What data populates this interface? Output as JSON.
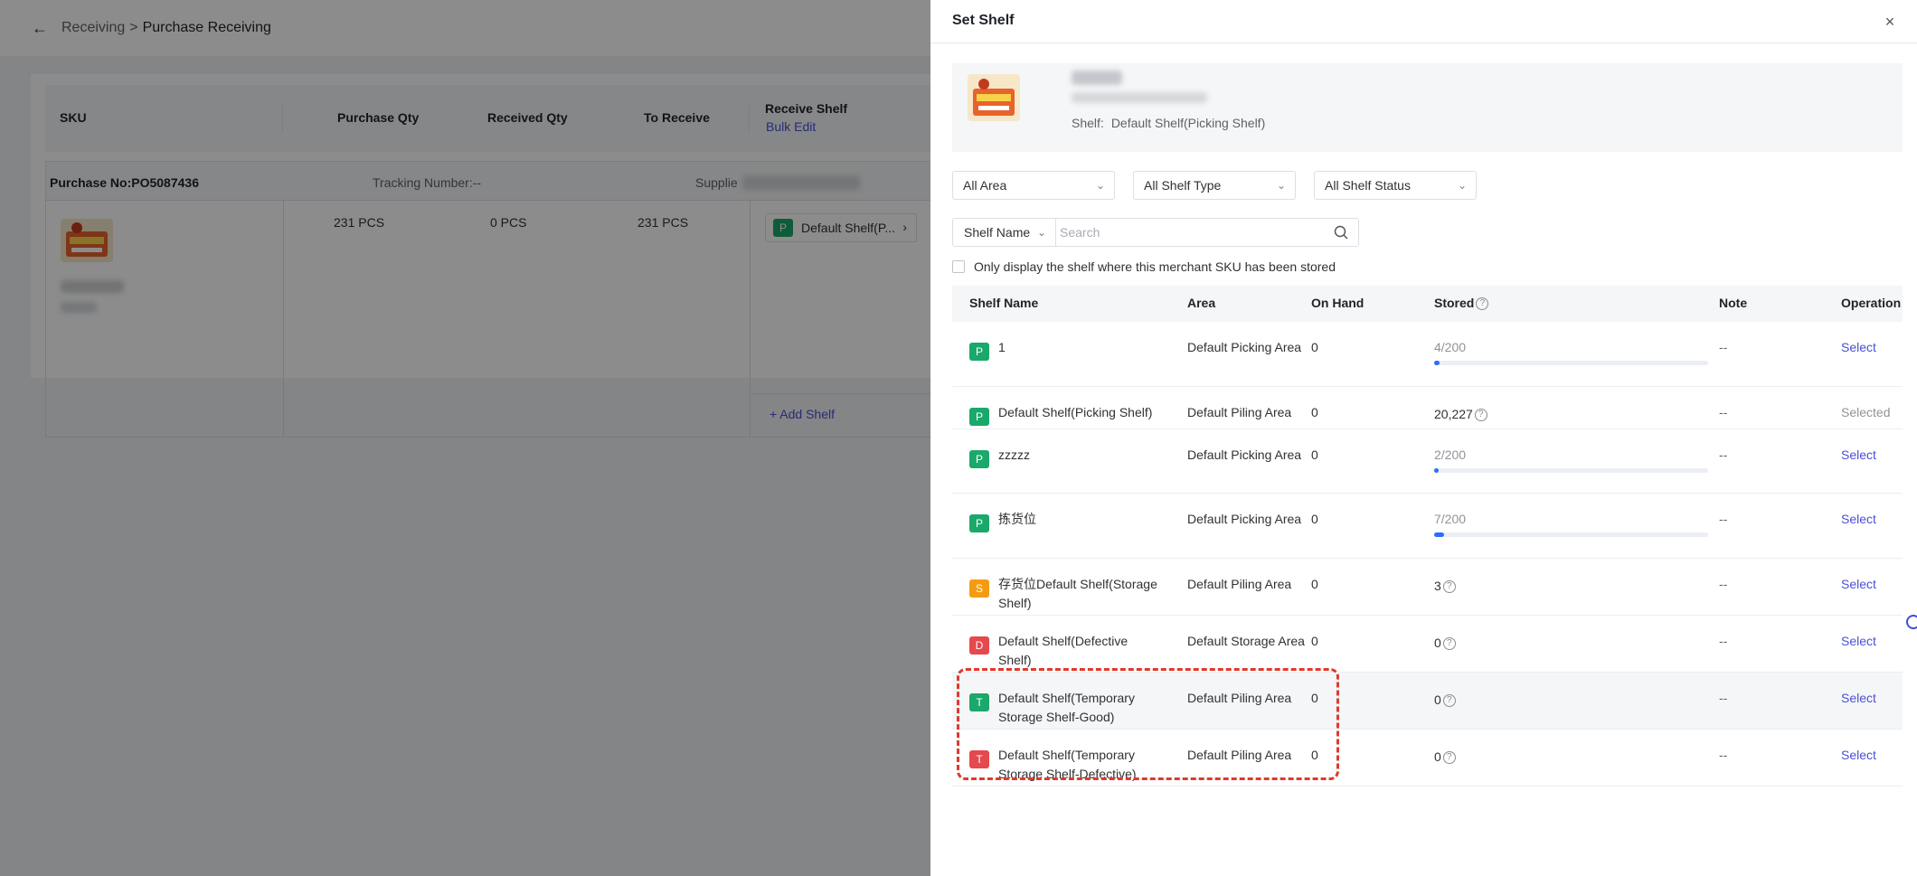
{
  "breadcrumb": {
    "parent": "Receiving",
    "separator": ">",
    "current": "Purchase Receiving"
  },
  "main_table": {
    "headers": {
      "sku": "SKU",
      "purchase_qty": "Purchase Qty",
      "received_qty": "Received Qty",
      "to_receive": "To Receive",
      "receive_shelf": "Receive Shelf",
      "bulk_edit": "Bulk Edit"
    },
    "group": {
      "purchase_no": "Purchase No:PO5087436",
      "tracking": "Tracking Number:--",
      "supplier": "Supplie"
    },
    "row": {
      "purchase_qty": "231 PCS",
      "received_qty": "0 PCS",
      "to_receive": "231 PCS",
      "shelf_tag": "P",
      "shelf_name": "Default Shelf(P...",
      "add_shelf": "+ Add Shelf"
    }
  },
  "drawer": {
    "title": "Set Shelf",
    "product": {
      "shelf_label": "Shelf:",
      "shelf_value": "Default Shelf(Picking Shelf)"
    },
    "filters": {
      "area": "All Area",
      "shelf_type": "All Shelf Type",
      "shelf_status": "All Shelf Status"
    },
    "search": {
      "field": "Shelf Name",
      "placeholder": "Search"
    },
    "only_stored_label": "Only display the shelf where this merchant SKU has been stored",
    "columns": {
      "shelf_name": "Shelf Name",
      "area": "Area",
      "on_hand": "On Hand",
      "stored": "Stored",
      "note": "Note",
      "operation": "Operation"
    },
    "rows": [
      {
        "tag": "P",
        "tag_color": "#1aa86b",
        "name": "1",
        "area": "Default Picking Area",
        "on_hand": "0",
        "stored": "4/200",
        "fill": 0.02,
        "note": "--",
        "op": "Select"
      },
      {
        "tag": "P",
        "tag_color": "#1aa86b",
        "name": "Default Shelf(Picking Shelf)",
        "area": "Default Piling Area",
        "on_hand": "0",
        "stored": "20,227",
        "note": "--",
        "op": "Selected"
      },
      {
        "tag": "P",
        "tag_color": "#1aa86b",
        "name": "zzzzz",
        "area": "Default Picking Area",
        "on_hand": "0",
        "stored": "2/200",
        "fill": 0.01,
        "note": "--",
        "op": "Select"
      },
      {
        "tag": "P",
        "tag_color": "#1aa86b",
        "name": "拣货位",
        "area": "Default Picking Area",
        "on_hand": "0",
        "stored": "7/200",
        "fill": 0.035,
        "note": "--",
        "op": "Select"
      },
      {
        "tag": "S",
        "tag_color": "#f39c12",
        "name": "存货位Default Shelf(Storage Shelf)",
        "area": "Default Piling Area",
        "on_hand": "0",
        "stored": "3",
        "note": "--",
        "op": "Select"
      },
      {
        "tag": "D",
        "tag_color": "#e5484d",
        "name": "Default Shelf(Defective Shelf)",
        "area": "Default Storage Area",
        "on_hand": "0",
        "stored": "0",
        "note": "--",
        "op": "Select"
      },
      {
        "tag": "T",
        "tag_color": "#1aa86b",
        "name": "Default Shelf(Temporary Storage Shelf-Good)",
        "area": "Default Piling Area",
        "on_hand": "0",
        "stored": "0",
        "note": "--",
        "op": "Select"
      },
      {
        "tag": "T",
        "tag_color": "#e5484d",
        "name": "Default Shelf(Temporary Storage Shelf-Defective)",
        "area": "Default Piling Area",
        "on_hand": "0",
        "stored": "0",
        "note": "--",
        "op": "Select"
      }
    ]
  }
}
